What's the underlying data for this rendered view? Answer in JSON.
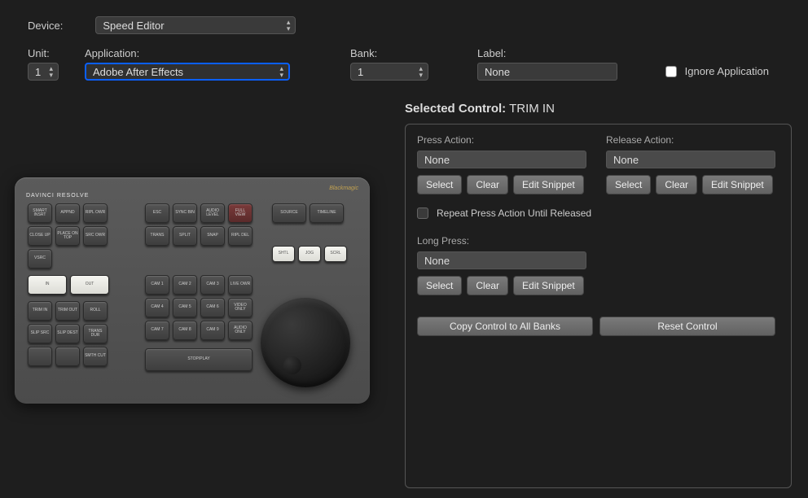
{
  "top": {
    "device_label": "Device:",
    "device_value": "Speed Editor",
    "unit_label": "Unit:",
    "unit_value": "1",
    "application_label": "Application:",
    "application_value": "Adobe After Effects",
    "bank_label": "Bank:",
    "bank_value": "1",
    "label_label": "Label:",
    "label_value": "None",
    "ignore_label": "Ignore Application"
  },
  "selected": {
    "prefix": "Selected Control:",
    "value": "TRIM IN"
  },
  "actions": {
    "press_label": "Press Action:",
    "press_value": "None",
    "release_label": "Release Action:",
    "release_value": "None",
    "longpress_label": "Long Press:",
    "longpress_value": "None",
    "select_btn": "Select",
    "clear_btn": "Clear",
    "edit_btn": "Edit Snippet",
    "repeat_label": "Repeat Press Action Until Released",
    "copy_btn": "Copy Control to All Banks",
    "reset_btn": "Reset Control"
  },
  "hardware": {
    "brand": "DAVINCI RESOLVE",
    "logo": "Blackmagic",
    "row1": [
      "SMART INSRT",
      "APPND",
      "RIPL OWR"
    ],
    "row2": [
      "CLOSE UP",
      "PLACE ON TOP",
      "SRC OWR"
    ],
    "row3": [
      "VSRC"
    ],
    "esc_row": [
      "ESC",
      "SYNC BIN",
      "AUDIO LEVEL",
      "FULL VIEW"
    ],
    "trans_row": [
      "TRANS",
      "SPLIT",
      "SNAP",
      "RIPL DEL"
    ],
    "cam_row1": [
      "CAM 1",
      "CAM 2",
      "CAM 3",
      "LIVE OWR"
    ],
    "cam_row2": [
      "CAM 4",
      "CAM 5",
      "CAM 6",
      "VIDEO ONLY"
    ],
    "cam_row3": [
      "CAM 7",
      "CAM 8",
      "CAM 9",
      "AUDIO ONLY"
    ],
    "stopplay": "STOP/PLAY",
    "source_row": [
      "SOURCE",
      "TIMELINE"
    ],
    "jog_modes": [
      "SHTL",
      "JOG",
      "SCRL"
    ],
    "inout": [
      "IN",
      "OUT"
    ],
    "trim_row": [
      "TRIM IN",
      "TRIM OUT",
      "ROLL"
    ],
    "slip_row": [
      "SLIP SRC",
      "SLIP DEST",
      "TRANS DUR"
    ],
    "smth_row": [
      "",
      "",
      "SMTH CUT"
    ]
  }
}
